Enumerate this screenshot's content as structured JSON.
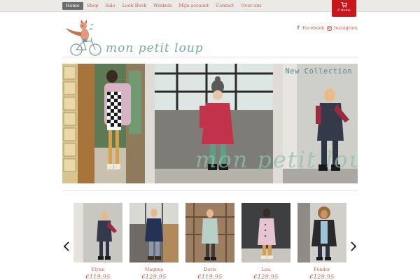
{
  "nav": {
    "items": [
      {
        "label": "Home",
        "active": true
      },
      {
        "label": "Shop",
        "active": false
      },
      {
        "label": "Sale",
        "active": false
      },
      {
        "label": "Look Book",
        "active": false
      },
      {
        "label": "Winkels",
        "active": false
      },
      {
        "label": "Mijn account",
        "active": false
      },
      {
        "label": "Contact",
        "active": false
      },
      {
        "label": "Over ons",
        "active": false
      }
    ]
  },
  "cart": {
    "label": "0 items",
    "icon": "shopping-cart-icon",
    "color": "#c8161d"
  },
  "social": {
    "facebook": {
      "label": "Facebook",
      "icon": "facebook-icon"
    },
    "instagram": {
      "label": "Instagram",
      "icon": "instagram-icon"
    }
  },
  "brand": {
    "name": "mon petit loup",
    "logo_icon": "fox-on-bicycle-icon"
  },
  "hero": {
    "caption": "New Collection",
    "watermark": "mon petit loup"
  },
  "products": [
    {
      "name": "Flynn",
      "price": "€119,95"
    },
    {
      "name": "Magnus",
      "price": "€129,95"
    },
    {
      "name": "Doris",
      "price": "€119,95"
    },
    {
      "name": "Lou",
      "price": "€129,95"
    },
    {
      "name": "Fender",
      "price": "€129,95"
    }
  ],
  "colors": {
    "accent": "#c0604e",
    "cart": "#c8161d",
    "caption": "#5a8a8a",
    "topbar": "#eceae6"
  }
}
